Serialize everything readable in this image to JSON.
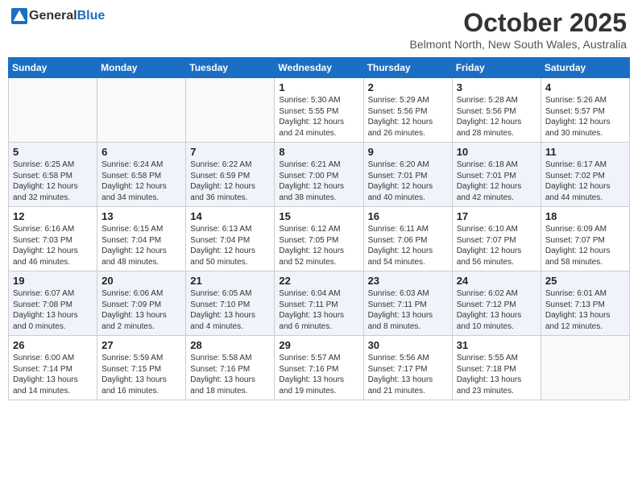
{
  "header": {
    "logo_general": "General",
    "logo_blue": "Blue",
    "month": "October 2025",
    "location": "Belmont North, New South Wales, Australia"
  },
  "weekdays": [
    "Sunday",
    "Monday",
    "Tuesday",
    "Wednesday",
    "Thursday",
    "Friday",
    "Saturday"
  ],
  "weeks": [
    [
      {
        "day": "",
        "info": ""
      },
      {
        "day": "",
        "info": ""
      },
      {
        "day": "",
        "info": ""
      },
      {
        "day": "1",
        "info": "Sunrise: 5:30 AM\nSunset: 5:55 PM\nDaylight: 12 hours and 24 minutes."
      },
      {
        "day": "2",
        "info": "Sunrise: 5:29 AM\nSunset: 5:56 PM\nDaylight: 12 hours and 26 minutes."
      },
      {
        "day": "3",
        "info": "Sunrise: 5:28 AM\nSunset: 5:56 PM\nDaylight: 12 hours and 28 minutes."
      },
      {
        "day": "4",
        "info": "Sunrise: 5:26 AM\nSunset: 5:57 PM\nDaylight: 12 hours and 30 minutes."
      }
    ],
    [
      {
        "day": "5",
        "info": "Sunrise: 6:25 AM\nSunset: 6:58 PM\nDaylight: 12 hours and 32 minutes."
      },
      {
        "day": "6",
        "info": "Sunrise: 6:24 AM\nSunset: 6:58 PM\nDaylight: 12 hours and 34 minutes."
      },
      {
        "day": "7",
        "info": "Sunrise: 6:22 AM\nSunset: 6:59 PM\nDaylight: 12 hours and 36 minutes."
      },
      {
        "day": "8",
        "info": "Sunrise: 6:21 AM\nSunset: 7:00 PM\nDaylight: 12 hours and 38 minutes."
      },
      {
        "day": "9",
        "info": "Sunrise: 6:20 AM\nSunset: 7:01 PM\nDaylight: 12 hours and 40 minutes."
      },
      {
        "day": "10",
        "info": "Sunrise: 6:18 AM\nSunset: 7:01 PM\nDaylight: 12 hours and 42 minutes."
      },
      {
        "day": "11",
        "info": "Sunrise: 6:17 AM\nSunset: 7:02 PM\nDaylight: 12 hours and 44 minutes."
      }
    ],
    [
      {
        "day": "12",
        "info": "Sunrise: 6:16 AM\nSunset: 7:03 PM\nDaylight: 12 hours and 46 minutes."
      },
      {
        "day": "13",
        "info": "Sunrise: 6:15 AM\nSunset: 7:04 PM\nDaylight: 12 hours and 48 minutes."
      },
      {
        "day": "14",
        "info": "Sunrise: 6:13 AM\nSunset: 7:04 PM\nDaylight: 12 hours and 50 minutes."
      },
      {
        "day": "15",
        "info": "Sunrise: 6:12 AM\nSunset: 7:05 PM\nDaylight: 12 hours and 52 minutes."
      },
      {
        "day": "16",
        "info": "Sunrise: 6:11 AM\nSunset: 7:06 PM\nDaylight: 12 hours and 54 minutes."
      },
      {
        "day": "17",
        "info": "Sunrise: 6:10 AM\nSunset: 7:07 PM\nDaylight: 12 hours and 56 minutes."
      },
      {
        "day": "18",
        "info": "Sunrise: 6:09 AM\nSunset: 7:07 PM\nDaylight: 12 hours and 58 minutes."
      }
    ],
    [
      {
        "day": "19",
        "info": "Sunrise: 6:07 AM\nSunset: 7:08 PM\nDaylight: 13 hours and 0 minutes."
      },
      {
        "day": "20",
        "info": "Sunrise: 6:06 AM\nSunset: 7:09 PM\nDaylight: 13 hours and 2 minutes."
      },
      {
        "day": "21",
        "info": "Sunrise: 6:05 AM\nSunset: 7:10 PM\nDaylight: 13 hours and 4 minutes."
      },
      {
        "day": "22",
        "info": "Sunrise: 6:04 AM\nSunset: 7:11 PM\nDaylight: 13 hours and 6 minutes."
      },
      {
        "day": "23",
        "info": "Sunrise: 6:03 AM\nSunset: 7:11 PM\nDaylight: 13 hours and 8 minutes."
      },
      {
        "day": "24",
        "info": "Sunrise: 6:02 AM\nSunset: 7:12 PM\nDaylight: 13 hours and 10 minutes."
      },
      {
        "day": "25",
        "info": "Sunrise: 6:01 AM\nSunset: 7:13 PM\nDaylight: 13 hours and 12 minutes."
      }
    ],
    [
      {
        "day": "26",
        "info": "Sunrise: 6:00 AM\nSunset: 7:14 PM\nDaylight: 13 hours and 14 minutes."
      },
      {
        "day": "27",
        "info": "Sunrise: 5:59 AM\nSunset: 7:15 PM\nDaylight: 13 hours and 16 minutes."
      },
      {
        "day": "28",
        "info": "Sunrise: 5:58 AM\nSunset: 7:16 PM\nDaylight: 13 hours and 18 minutes."
      },
      {
        "day": "29",
        "info": "Sunrise: 5:57 AM\nSunset: 7:16 PM\nDaylight: 13 hours and 19 minutes."
      },
      {
        "day": "30",
        "info": "Sunrise: 5:56 AM\nSunset: 7:17 PM\nDaylight: 13 hours and 21 minutes."
      },
      {
        "day": "31",
        "info": "Sunrise: 5:55 AM\nSunset: 7:18 PM\nDaylight: 13 hours and 23 minutes."
      },
      {
        "day": "",
        "info": ""
      }
    ]
  ]
}
